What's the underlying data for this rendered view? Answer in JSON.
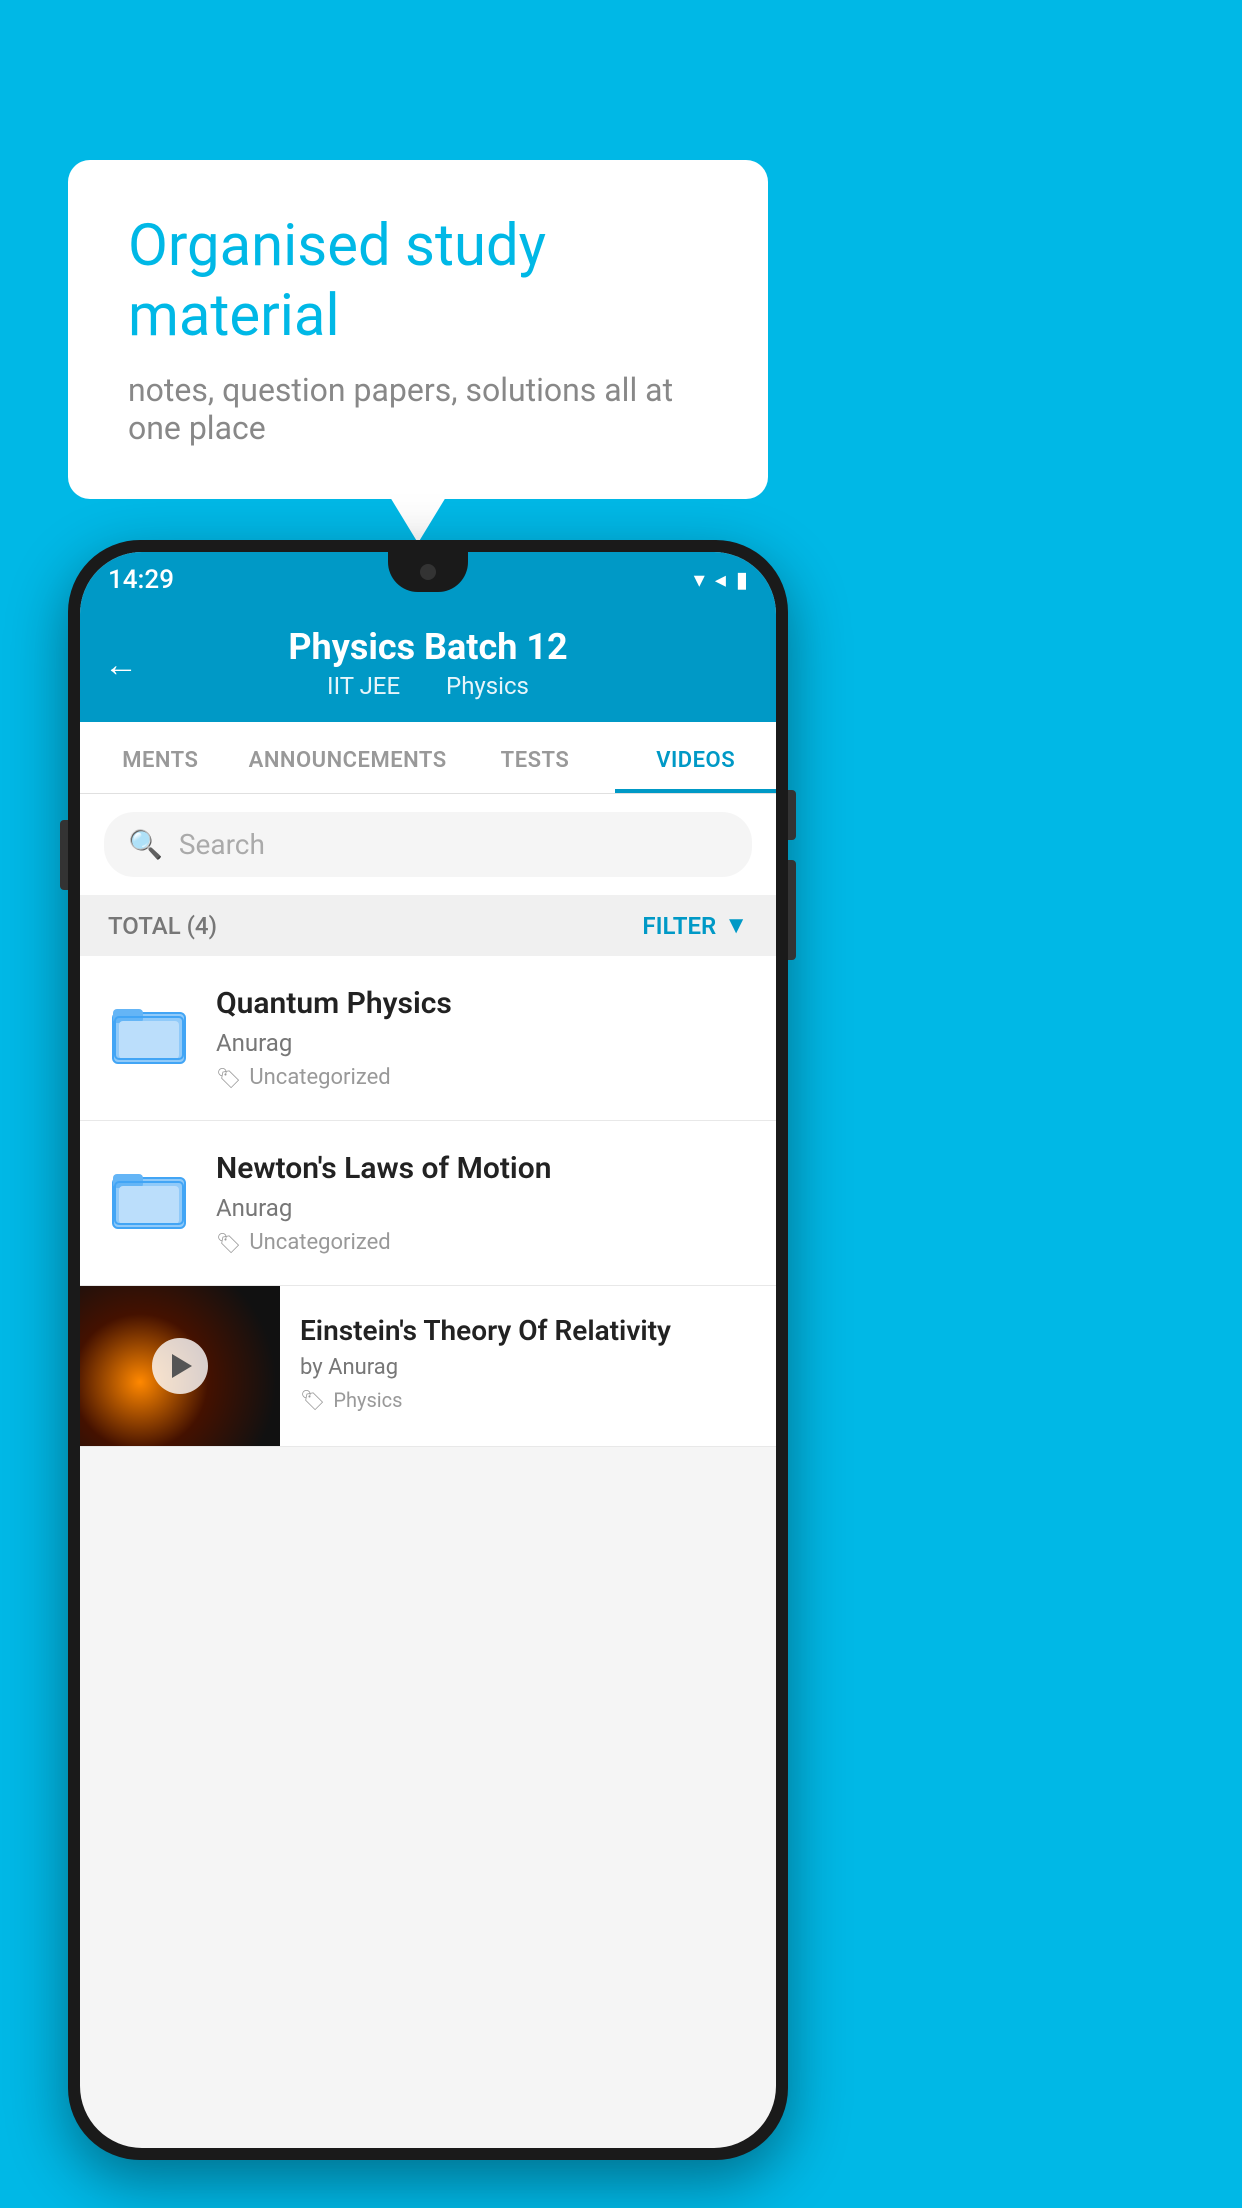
{
  "background": {
    "color": "#00B8E6"
  },
  "speech_bubble": {
    "title": "Organised study material",
    "subtitle": "notes, question papers, solutions all at one place"
  },
  "phone": {
    "status_bar": {
      "time": "14:29",
      "icons": [
        "wifi",
        "signal",
        "battery"
      ]
    },
    "header": {
      "back_label": "←",
      "title": "Physics Batch 12",
      "subtitle_left": "IIT JEE",
      "subtitle_right": "Physics"
    },
    "tabs": [
      {
        "label": "MENTS",
        "active": false
      },
      {
        "label": "ANNOUNCEMENTS",
        "active": false
      },
      {
        "label": "TESTS",
        "active": false
      },
      {
        "label": "VIDEOS",
        "active": true
      }
    ],
    "search": {
      "placeholder": "Search"
    },
    "filter_bar": {
      "total_label": "TOTAL (4)",
      "filter_label": "FILTER"
    },
    "videos": [
      {
        "id": 1,
        "title": "Quantum Physics",
        "author": "Anurag",
        "tag": "Uncategorized",
        "has_thumb": false
      },
      {
        "id": 2,
        "title": "Newton's Laws of Motion",
        "author": "Anurag",
        "tag": "Uncategorized",
        "has_thumb": false
      },
      {
        "id": 3,
        "title": "Einstein's Theory Of Relativity",
        "author": "by Anurag",
        "tag": "Physics",
        "has_thumb": true
      }
    ]
  }
}
